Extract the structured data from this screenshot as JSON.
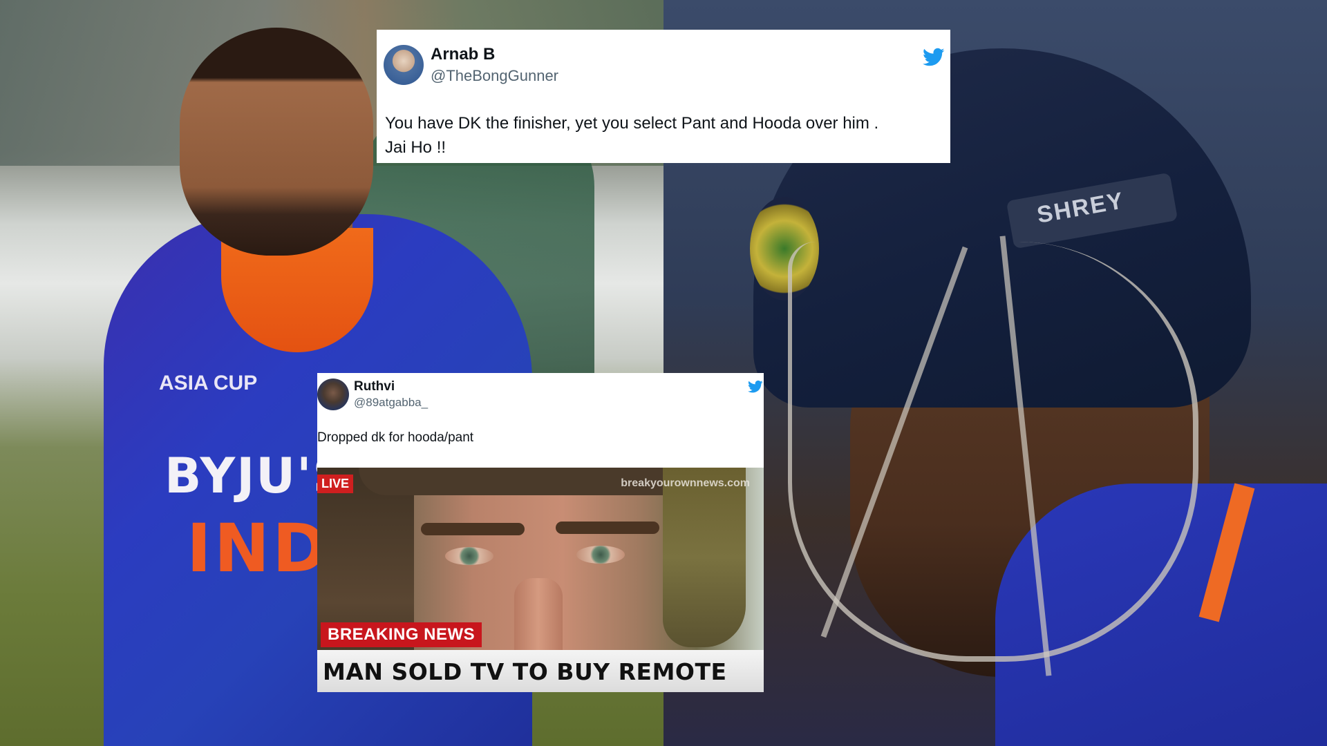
{
  "tweets": [
    {
      "name": "Arnab B",
      "handle": "@TheBongGunner",
      "text_line1": "You have DK the finisher, yet you select Pant and Hooda over him .",
      "text_line2": "Jai Ho !!",
      "icon": "twitter-bird-icon"
    },
    {
      "name": "Ruthvi",
      "handle": "@89atgabba_",
      "text": "Dropped dk for hooda/pant",
      "icon": "twitter-bird-icon",
      "meme": {
        "live_label": "LIVE",
        "watermark": "breakyourownnews.com",
        "breaking_label": "BREAKING NEWS",
        "headline": "MAN SOLD TV TO BUY REMOTE"
      }
    }
  ],
  "background": {
    "left_jersey_sponsor": "BYJU'S",
    "left_jersey_team": "INDIA",
    "left_jersey_badge": "ASIA CUP",
    "right_helmet_strip": "SHREY"
  },
  "colors": {
    "twitter_blue": "#1d9bf0",
    "india_blue": "#2b3cc0",
    "india_orange": "#ef5b22",
    "breaking_red": "#c8161d"
  }
}
